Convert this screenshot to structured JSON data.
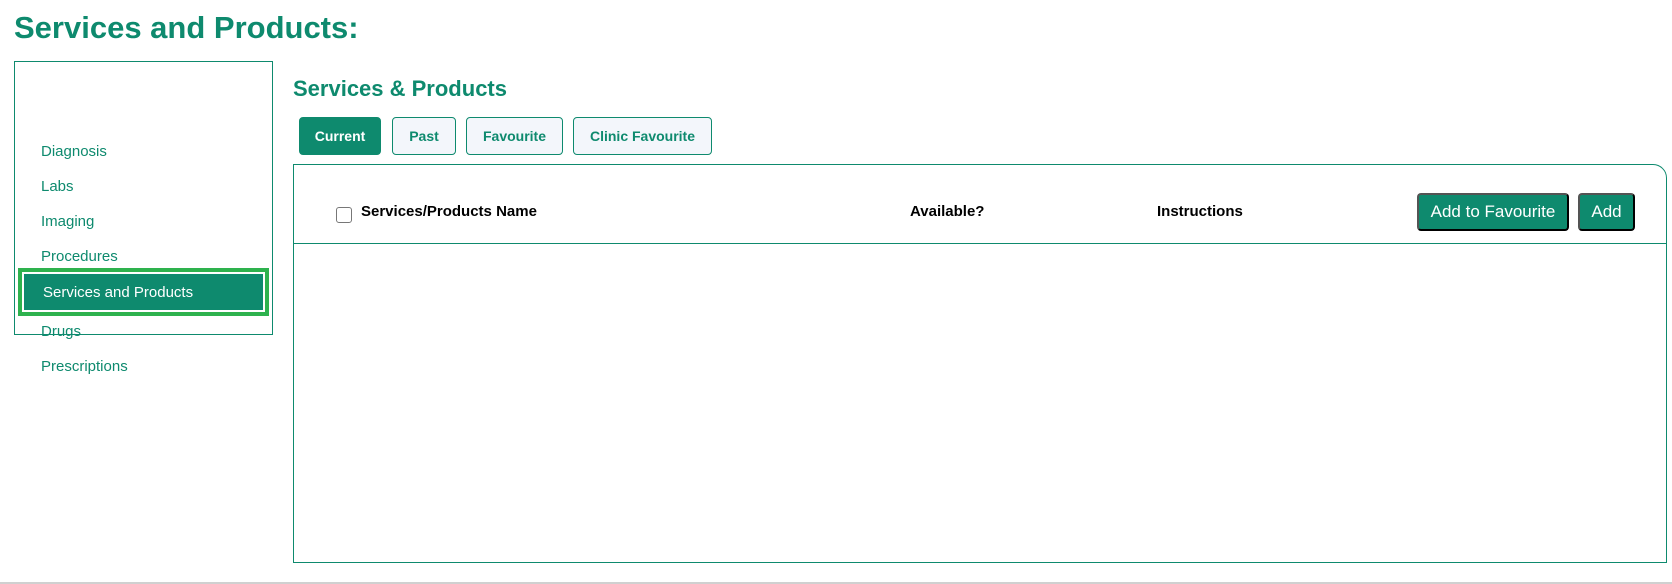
{
  "page": {
    "title": "Services and Products:"
  },
  "sidebar": {
    "items": [
      {
        "label": "Diagnosis"
      },
      {
        "label": "Labs"
      },
      {
        "label": "Imaging"
      },
      {
        "label": "Procedures"
      },
      {
        "label": "Services and Products"
      },
      {
        "label": "Drugs"
      },
      {
        "label": "Prescriptions"
      }
    ],
    "active_index": 4
  },
  "main": {
    "title": "Services & Products",
    "tabs": [
      {
        "label": "Current"
      },
      {
        "label": "Past"
      },
      {
        "label": "Favourite"
      },
      {
        "label": "Clinic Favourite"
      }
    ],
    "active_tab": 0,
    "table": {
      "columns": [
        "Services/Products Name",
        "Available?",
        "Instructions"
      ],
      "rows": [],
      "actions": {
        "add_to_favourite_label": "Add to Favourite",
        "add_label": "Add"
      }
    }
  },
  "colors": {
    "accent": "#0e8a6e",
    "highlight": "#2eb24e"
  }
}
